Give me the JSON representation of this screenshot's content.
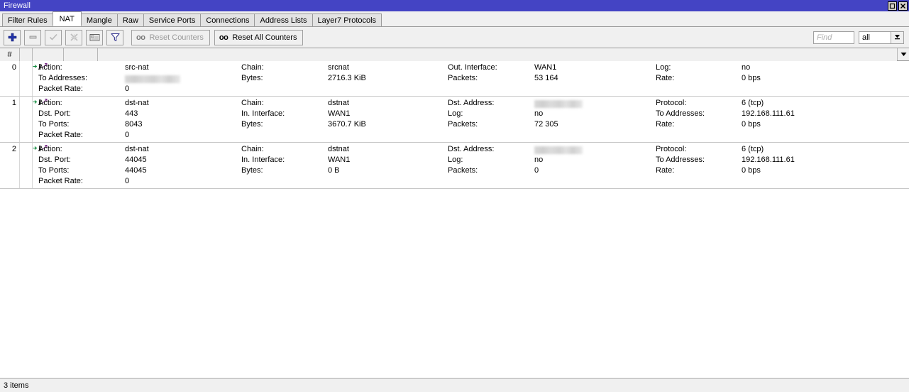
{
  "window": {
    "title": "Firewall",
    "buttons": [
      {
        "name": "maximize-button",
        "glyph": "□"
      },
      {
        "name": "close-button",
        "glyph": "✕"
      }
    ]
  },
  "tabs": [
    {
      "label": "Filter Rules",
      "active": false
    },
    {
      "label": "NAT",
      "active": true
    },
    {
      "label": "Mangle",
      "active": false
    },
    {
      "label": "Raw",
      "active": false
    },
    {
      "label": "Service Ports",
      "active": false
    },
    {
      "label": "Connections",
      "active": false
    },
    {
      "label": "Address Lists",
      "active": false
    },
    {
      "label": "Layer7 Protocols",
      "active": false
    }
  ],
  "toolbar": {
    "icon_buttons": [
      {
        "name": "add-button",
        "icon": "plus-icon",
        "enabled": true
      },
      {
        "name": "remove-button",
        "icon": "minus-icon",
        "enabled": true
      },
      {
        "name": "enable-button",
        "icon": "check-icon",
        "enabled": false
      },
      {
        "name": "disable-button",
        "icon": "cross-icon",
        "enabled": false
      },
      {
        "name": "comment-button",
        "icon": "comment-icon",
        "enabled": true
      },
      {
        "name": "filter-button",
        "icon": "funnel-icon",
        "enabled": true
      }
    ],
    "reset_counters_label": "Reset Counters",
    "reset_counters_enabled": false,
    "reset_all_counters_label": "Reset All Counters",
    "reset_all_counters_enabled": true,
    "counter_icon_label": "oo",
    "find_placeholder": "Find",
    "find_value": "",
    "filter_selected": "all",
    "filter_options": [
      "all"
    ]
  },
  "table": {
    "columns": [
      {
        "label": "#",
        "name": "column-index"
      },
      {
        "label": "",
        "name": "column-flags"
      },
      {
        "label": "",
        "name": "column-a"
      },
      {
        "label": "",
        "name": "column-b"
      },
      {
        "label": "",
        "name": "column-rest"
      }
    ],
    "rows": [
      {
        "index": "0",
        "prefix_icons": [
          "arrow-right-icon",
          "pipe-icon",
          "nat-arrow-icon"
        ],
        "fields": [
          {
            "label": "Action:",
            "value": "src-nat",
            "col": 0,
            "line": 0
          },
          {
            "label": "To Addresses:",
            "value": "",
            "col": 0,
            "line": 1,
            "redacted": true,
            "redact_width": 78
          },
          {
            "label": "Packet Rate:",
            "value": "0",
            "col": 0,
            "line": 2
          },
          {
            "label": "Chain:",
            "value": "srcnat",
            "col": 1,
            "line": 0
          },
          {
            "label": "Bytes:",
            "value": "2716.3 KiB",
            "col": 1,
            "line": 1
          },
          {
            "label": "Out. Interface:",
            "value": "WAN1",
            "col": 2,
            "line": 0
          },
          {
            "label": "Packets:",
            "value": "53 164",
            "col": 2,
            "line": 1
          },
          {
            "label": "Log:",
            "value": "no",
            "col": 3,
            "line": 0
          },
          {
            "label": "Rate:",
            "value": "0 bps",
            "col": 3,
            "line": 1
          }
        ]
      },
      {
        "index": "1",
        "prefix_icons": [
          "arrow-right-icon",
          "pipe-icon",
          "nat-arrow-icon"
        ],
        "fields": [
          {
            "label": "Action:",
            "value": "dst-nat",
            "col": 0,
            "line": 0
          },
          {
            "label": "Dst. Port:",
            "value": "443",
            "col": 0,
            "line": 1
          },
          {
            "label": "To Ports:",
            "value": "8043",
            "col": 0,
            "line": 2
          },
          {
            "label": "Packet Rate:",
            "value": "0",
            "col": 0,
            "line": 3
          },
          {
            "label": "Chain:",
            "value": "dstnat",
            "col": 1,
            "line": 0
          },
          {
            "label": "In. Interface:",
            "value": "WAN1",
            "col": 1,
            "line": 1
          },
          {
            "label": "Bytes:",
            "value": "3670.7 KiB",
            "col": 1,
            "line": 2
          },
          {
            "label": "Dst. Address:",
            "value": "",
            "col": 2,
            "line": 0,
            "redacted": true,
            "redact_width": 68
          },
          {
            "label": "Log:",
            "value": "no",
            "col": 2,
            "line": 1
          },
          {
            "label": "Packets:",
            "value": "72 305",
            "col": 2,
            "line": 2
          },
          {
            "label": "Protocol:",
            "value": "6 (tcp)",
            "col": 3,
            "line": 0
          },
          {
            "label": "To Addresses:",
            "value": "192.168.111.61",
            "col": 3,
            "line": 1
          },
          {
            "label": "Rate:",
            "value": "0 bps",
            "col": 3,
            "line": 2
          }
        ]
      },
      {
        "index": "2",
        "prefix_icons": [
          "arrow-right-icon",
          "pipe-icon",
          "nat-arrow-icon"
        ],
        "fields": [
          {
            "label": "Action:",
            "value": "dst-nat",
            "col": 0,
            "line": 0
          },
          {
            "label": "Dst. Port:",
            "value": "44045",
            "col": 0,
            "line": 1
          },
          {
            "label": "To Ports:",
            "value": "44045",
            "col": 0,
            "line": 2
          },
          {
            "label": "Packet Rate:",
            "value": "0",
            "col": 0,
            "line": 3
          },
          {
            "label": "Chain:",
            "value": "dstnat",
            "col": 1,
            "line": 0
          },
          {
            "label": "In. Interface:",
            "value": "WAN1",
            "col": 1,
            "line": 1
          },
          {
            "label": "Bytes:",
            "value": "0 B",
            "col": 1,
            "line": 2
          },
          {
            "label": "Dst. Address:",
            "value": "",
            "col": 2,
            "line": 0,
            "redacted": true,
            "redact_width": 68
          },
          {
            "label": "Log:",
            "value": "no",
            "col": 2,
            "line": 1
          },
          {
            "label": "Packets:",
            "value": "0",
            "col": 2,
            "line": 2
          },
          {
            "label": "Protocol:",
            "value": "6 (tcp)",
            "col": 3,
            "line": 0
          },
          {
            "label": "To Addresses:",
            "value": "192.168.111.61",
            "col": 3,
            "line": 1
          },
          {
            "label": "Rate:",
            "value": "0 bps",
            "col": 3,
            "line": 2
          }
        ]
      }
    ]
  },
  "statusbar": {
    "items_text": "3 items"
  },
  "colors": {
    "titlebar": "#4444c4",
    "titlebar_text": "#ffffff",
    "accent_plus": "#2233aa",
    "window_bg": "#f0f0f0",
    "table_bg": "#ffffff"
  }
}
